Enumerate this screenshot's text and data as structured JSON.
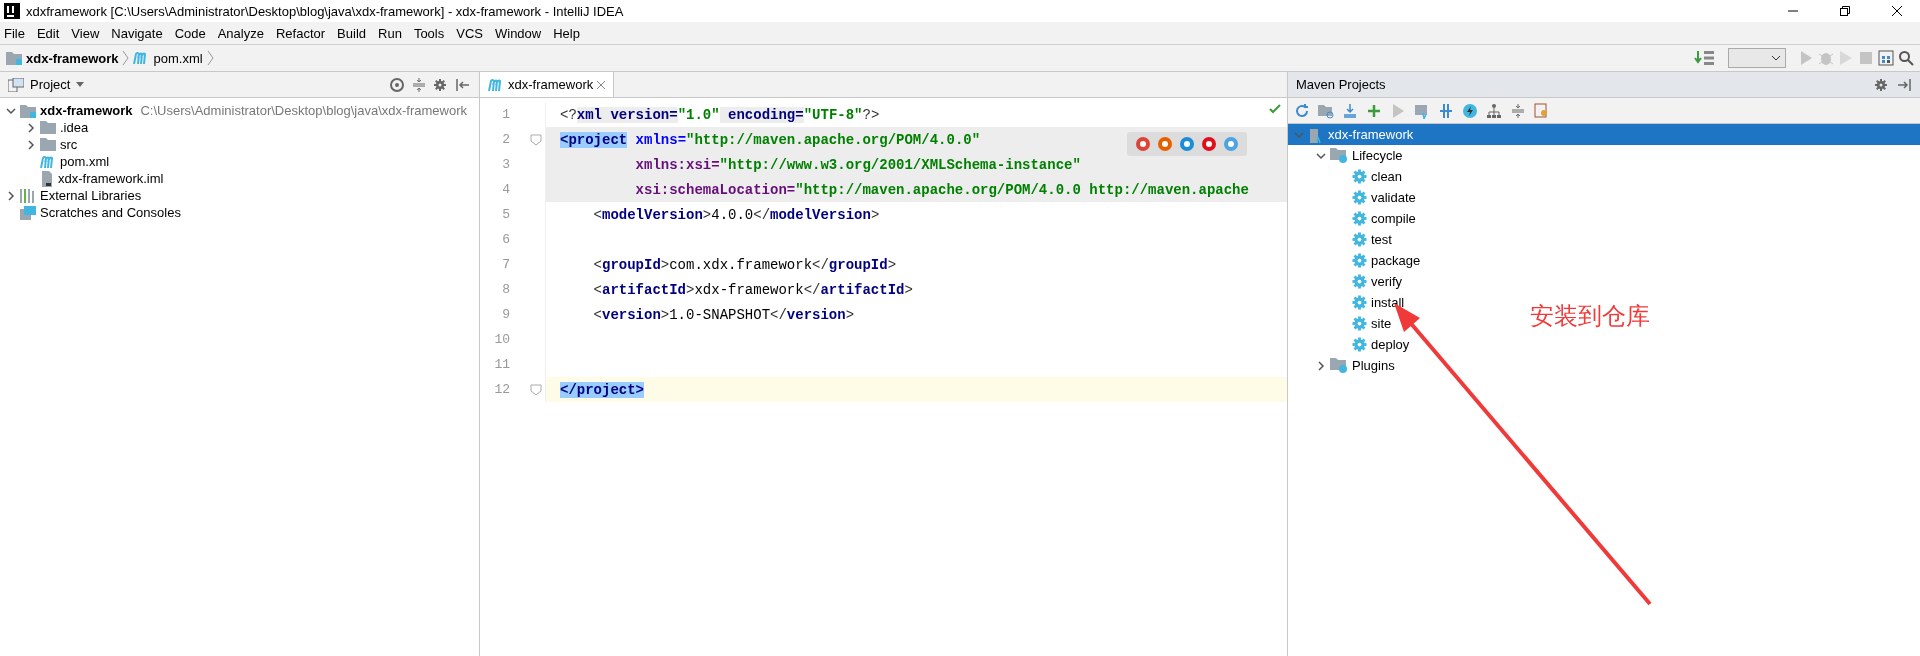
{
  "window": {
    "title": "xdxframework [C:\\Users\\Administrator\\Desktop\\blog\\java\\xdx-framework] - xdx-framework - IntelliJ IDEA"
  },
  "menu": [
    "File",
    "Edit",
    "View",
    "Navigate",
    "Code",
    "Analyze",
    "Refactor",
    "Build",
    "Run",
    "Tools",
    "VCS",
    "Window",
    "Help"
  ],
  "breadcrumb": [
    {
      "label": "xdx-framework",
      "kind": "module"
    },
    {
      "label": "pom.xml",
      "kind": "maven"
    }
  ],
  "project_panel": {
    "title": "Project",
    "tree": [
      {
        "label": "xdx-framework",
        "path": "C:\\Users\\Administrator\\Desktop\\blog\\java\\xdx-framework",
        "kind": "module",
        "expanded": true,
        "children": [
          {
            "label": ".idea",
            "kind": "folder",
            "expanded": false
          },
          {
            "label": "src",
            "kind": "folder",
            "expanded": false
          },
          {
            "label": "pom.xml",
            "kind": "maven"
          },
          {
            "label": "xdx-framework.iml",
            "kind": "file"
          }
        ]
      },
      {
        "label": "External Libraries",
        "kind": "library",
        "expanded": false
      },
      {
        "label": "Scratches and Consoles",
        "kind": "scratch"
      }
    ]
  },
  "editor": {
    "tabs": [
      {
        "label": "xdx-framework",
        "selected": true
      }
    ],
    "lines": [
      {
        "number": "1",
        "kind": "top",
        "highlighted": false,
        "current": false,
        "fold": false,
        "tokens": [
          {
            "kind": "punct",
            "text": "<?"
          },
          {
            "kind": "pi",
            "text": "xml version="
          },
          {
            "kind": "value",
            "text": "\"1.0\""
          },
          {
            "kind": "pi",
            "text": " encoding="
          },
          {
            "kind": "value",
            "text": "\"UTF-8\""
          },
          {
            "kind": "punct",
            "text": "?>"
          }
        ]
      },
      {
        "number": "2",
        "kind": "top",
        "highlighted": true,
        "current": false,
        "fold": true,
        "tokens": [
          {
            "kind": "matched",
            "text": "<project"
          },
          {
            "kind": "attr",
            "text": " xmlns="
          },
          {
            "kind": "value",
            "text": "\"http://maven.apache.org/POM/4.0.0\""
          }
        ]
      },
      {
        "number": "3",
        "kind": "continuation",
        "highlighted": true,
        "current": false,
        "fold": false,
        "tokens": [
          {
            "kind": "ns",
            "text": "xmlns:xsi="
          },
          {
            "kind": "value",
            "text": "\"http://www.w3.org/2001/XMLSchema-instance\""
          }
        ]
      },
      {
        "number": "4",
        "kind": "continuation",
        "highlighted": true,
        "current": false,
        "fold": false,
        "tokens": [
          {
            "kind": "ns",
            "text": "xsi:schemaLocation="
          },
          {
            "kind": "value",
            "text": "\"http://maven.apache.org/POM/4.0.0 http://maven.apache"
          }
        ]
      },
      {
        "number": "5",
        "kind": "child",
        "highlighted": false,
        "current": false,
        "fold": false,
        "tokens": [
          {
            "kind": "punct",
            "text": "<"
          },
          {
            "kind": "tag",
            "text": "modelVersion"
          },
          {
            "kind": "punct",
            "text": ">"
          },
          {
            "kind": "text",
            "text": "4.0.0"
          },
          {
            "kind": "punct",
            "text": "</"
          },
          {
            "kind": "tag",
            "text": "modelVersion"
          },
          {
            "kind": "punct",
            "text": ">"
          }
        ]
      },
      {
        "number": "6",
        "highlighted": false,
        "current": false,
        "fold": false
      },
      {
        "number": "7",
        "kind": "child",
        "highlighted": false,
        "current": false,
        "fold": false,
        "tokens": [
          {
            "kind": "punct",
            "text": "<"
          },
          {
            "kind": "tag",
            "text": "groupId"
          },
          {
            "kind": "punct",
            "text": ">"
          },
          {
            "kind": "text",
            "text": "com.xdx.framework"
          },
          {
            "kind": "punct",
            "text": "</"
          },
          {
            "kind": "tag",
            "text": "groupId"
          },
          {
            "kind": "punct",
            "text": ">"
          }
        ]
      },
      {
        "number": "8",
        "kind": "child",
        "highlighted": false,
        "current": false,
        "fold": false,
        "tokens": [
          {
            "kind": "punct",
            "text": "<"
          },
          {
            "kind": "tag",
            "text": "artifactId"
          },
          {
            "kind": "punct",
            "text": ">"
          },
          {
            "kind": "text",
            "text": "xdx-framework"
          },
          {
            "kind": "punct",
            "text": "</"
          },
          {
            "kind": "tag",
            "text": "artifactId"
          },
          {
            "kind": "punct",
            "text": ">"
          }
        ]
      },
      {
        "number": "9",
        "kind": "child",
        "highlighted": false,
        "current": false,
        "fold": false,
        "tokens": [
          {
            "kind": "punct",
            "text": "<"
          },
          {
            "kind": "tag",
            "text": "version"
          },
          {
            "kind": "punct",
            "text": ">"
          },
          {
            "kind": "text",
            "text": "1.0-SNAPSHOT"
          },
          {
            "kind": "punct",
            "text": "</"
          },
          {
            "kind": "tag",
            "text": "version"
          },
          {
            "kind": "punct",
            "text": ">"
          }
        ]
      },
      {
        "number": "10",
        "highlighted": false,
        "current": false,
        "fold": false
      },
      {
        "number": "11",
        "highlighted": false,
        "current": false,
        "fold": false
      },
      {
        "number": "12",
        "kind": "top",
        "highlighted": false,
        "current": true,
        "fold": true,
        "tokens": [
          {
            "kind": "matched",
            "text": "</project>"
          }
        ]
      }
    ]
  },
  "maven_panel": {
    "title": "Maven Projects",
    "tree": [
      {
        "label": "xdx-framework",
        "kind": "project",
        "selected": true,
        "expanded": true,
        "children": [
          {
            "label": "Lifecycle",
            "kind": "group",
            "selected": false,
            "expanded": true,
            "children": [
              {
                "label": "clean",
                "kind": "goal",
                "selected": false
              },
              {
                "label": "validate",
                "kind": "goal",
                "selected": false
              },
              {
                "label": "compile",
                "kind": "goal",
                "selected": false
              },
              {
                "label": "test",
                "kind": "goal",
                "selected": false
              },
              {
                "label": "package",
                "kind": "goal",
                "selected": false
              },
              {
                "label": "verify",
                "kind": "goal",
                "selected": false
              },
              {
                "label": "install",
                "kind": "goal",
                "selected": false
              },
              {
                "label": "site",
                "kind": "goal",
                "selected": false
              },
              {
                "label": "deploy",
                "kind": "goal",
                "selected": false
              }
            ]
          },
          {
            "label": "Plugins",
            "kind": "group",
            "selected": false,
            "expanded": false
          }
        ]
      }
    ]
  },
  "annotation": {
    "text": "安装到仓库"
  }
}
